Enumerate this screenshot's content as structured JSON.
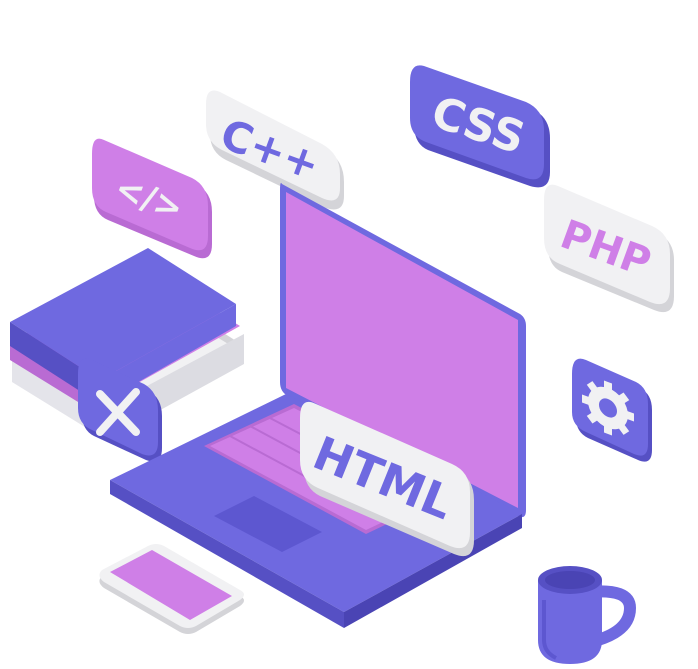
{
  "tiles": {
    "code": {
      "label": "</>"
    },
    "cpp": {
      "label": "C++"
    },
    "css": {
      "label": "CSS"
    },
    "php": {
      "label": "PHP"
    },
    "html": {
      "label": "HTML"
    }
  },
  "colors": {
    "purple": "#6f69e0",
    "purple_dark": "#5650c4",
    "pink": "#cf7fe7",
    "pink_dark": "#b96bd3",
    "tile_white": "#f1f1f3",
    "tile_shadow": "#d4d4d8"
  },
  "icons": [
    "code-tag-icon",
    "gear-icon",
    "close-x-icon"
  ]
}
